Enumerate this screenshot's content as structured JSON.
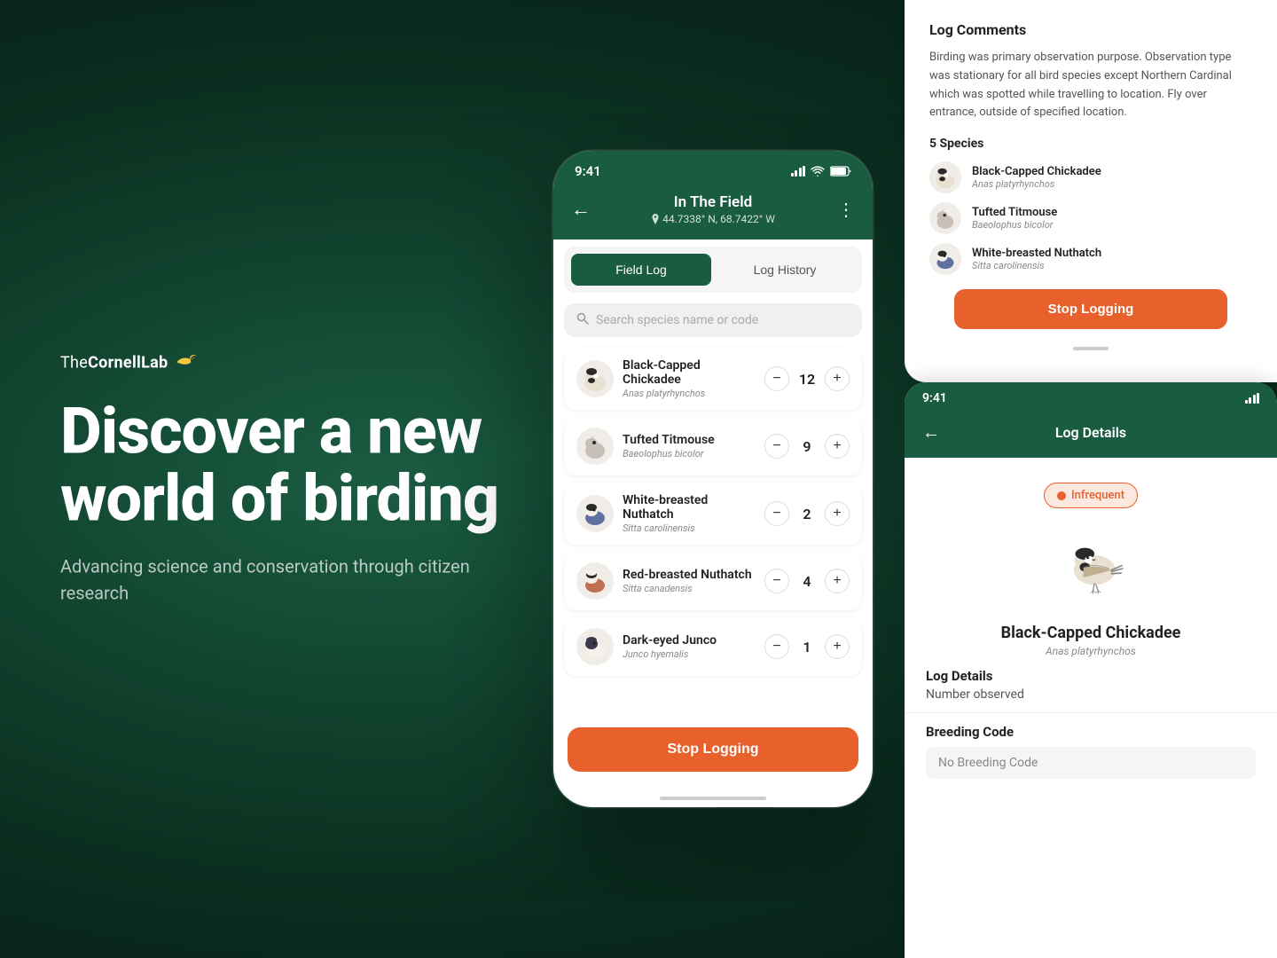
{
  "app": {
    "name": "TheCornellLab"
  },
  "branding": {
    "headline": "Discover a new world of birding",
    "subheadline": "Advancing science and conservation through citizen research"
  },
  "phone": {
    "status_time": "9:41",
    "header_title": "In The Field",
    "header_location": "44.7338° N, 68.7422° W",
    "tab_field_log": "Field Log",
    "tab_log_history": "Log History",
    "search_placeholder": "Search species name or code",
    "stop_logging": "Stop Logging",
    "birds": [
      {
        "name": "Black-Capped Chickadee",
        "latin": "Anas platyrhynchos",
        "count": 12,
        "color": "#c8a96e"
      },
      {
        "name": "Tufted Titmouse",
        "latin": "Baeolophus bicolor",
        "count": 9,
        "color": "#b0a090"
      },
      {
        "name": "White-breasted Nuthatch",
        "latin": "Sitta carolinensis",
        "count": 2,
        "color": "#8090a0"
      },
      {
        "name": "Red-breasted Nuthatch",
        "latin": "Sitta canadensis",
        "count": 4,
        "color": "#c87050"
      },
      {
        "name": "Dark-eyed Junco",
        "latin": "Junco hyemalis",
        "count": 1,
        "color": "#606070"
      }
    ]
  },
  "log_panel": {
    "title": "Log Comments",
    "comment": "Birding was primary observation purpose. Observation type was stationary for all bird species except Northern Cardinal which was spotted while travelling to location. Fly over entrance, outside of specified location.",
    "species_count": "5 Species",
    "species": [
      {
        "name": "Black-Capped Chickadee",
        "latin": "Anas platyrhynchos"
      },
      {
        "name": "Tufted Titmouse",
        "latin": "Baeolophus bicolor"
      },
      {
        "name": "White-breasted Nuthatch",
        "latin": "Sitta carolinensis"
      }
    ],
    "stop_logging": "Stop Logging"
  },
  "log_details": {
    "status_time": "9:41",
    "title": "Log Details",
    "badge": "Infrequent",
    "bird_name": "Black-Capped Chickadee",
    "bird_latin": "Anas platyrhynchos",
    "section_log_details": "Log Details",
    "number_observed_label": "Number observed",
    "breeding_code_label": "Breeding Code",
    "no_breeding_code": "No Breeding Code"
  }
}
